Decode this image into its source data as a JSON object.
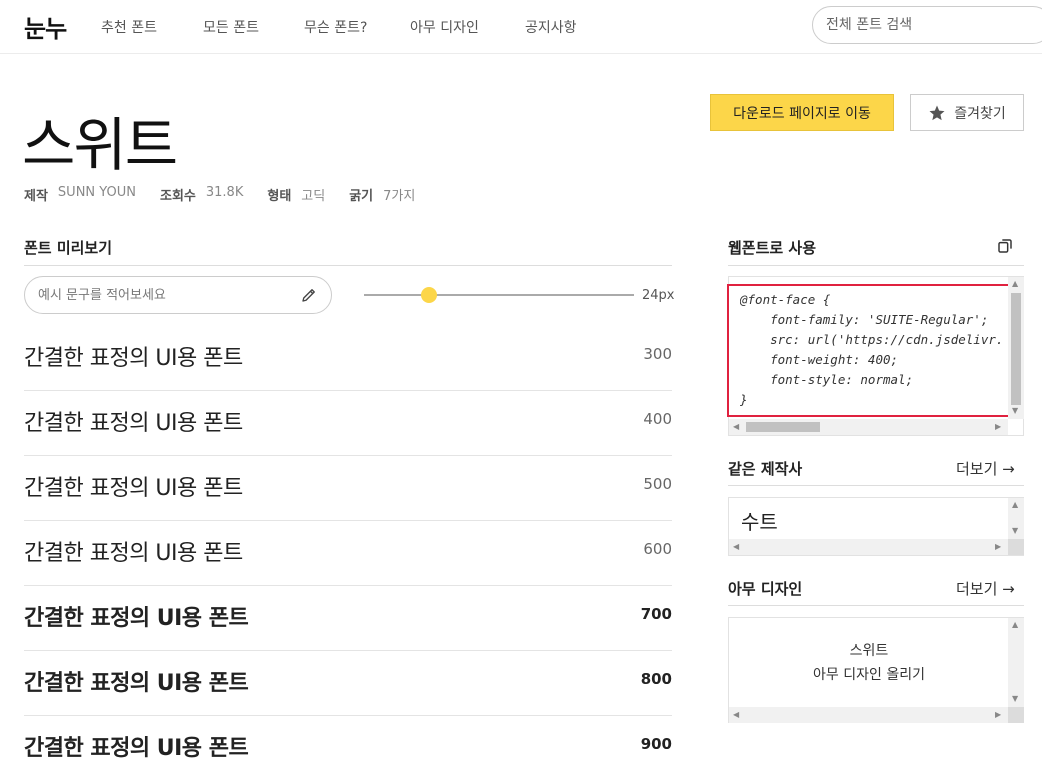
{
  "nav": {
    "logo": "눈누",
    "items": [
      "추천 폰트",
      "모든 폰트",
      "무슨 폰트?",
      "아무 디자인",
      "공지사항"
    ],
    "search_placeholder": "전체 폰트 검색"
  },
  "font": {
    "name": "스위트",
    "meta": [
      {
        "key": "제작",
        "value": "SUNN YOUN"
      },
      {
        "key": "조회수",
        "value": "31.8K"
      },
      {
        "key": "형태",
        "value": "고딕"
      },
      {
        "key": "굵기",
        "value": "7가지"
      }
    ]
  },
  "actions": {
    "download_label": "다운로드 페이지로 이동",
    "favorite_label": "즐겨찾기"
  },
  "preview": {
    "title": "폰트 미리보기",
    "input_placeholder": "예시 문구를 적어보세요",
    "size_label": "24px",
    "size_fraction": 0.24,
    "sample_text": "간결한 표정의 UI용 폰트",
    "weights": [
      "300",
      "400",
      "500",
      "600",
      "700",
      "800",
      "900"
    ]
  },
  "webfont": {
    "title": "웹폰트로 사용",
    "code_lines": [
      "@font-face {",
      "    font-family: 'SUITE-Regular';",
      "    src: url('https://cdn.jsdelivr.",
      "    font-weight: 400;",
      "    font-style: normal;",
      "}"
    ]
  },
  "same_maker": {
    "title": "같은 제작사",
    "more_label": "더보기 →",
    "items": [
      "수트"
    ]
  },
  "any_design": {
    "title": "아무 디자인",
    "more_label": "더보기 →",
    "line1": "스위트",
    "line2": "아무 디자인 올리기"
  },
  "colors": {
    "accent_yellow": "#fcd649",
    "highlight_red": "#e0213f"
  }
}
